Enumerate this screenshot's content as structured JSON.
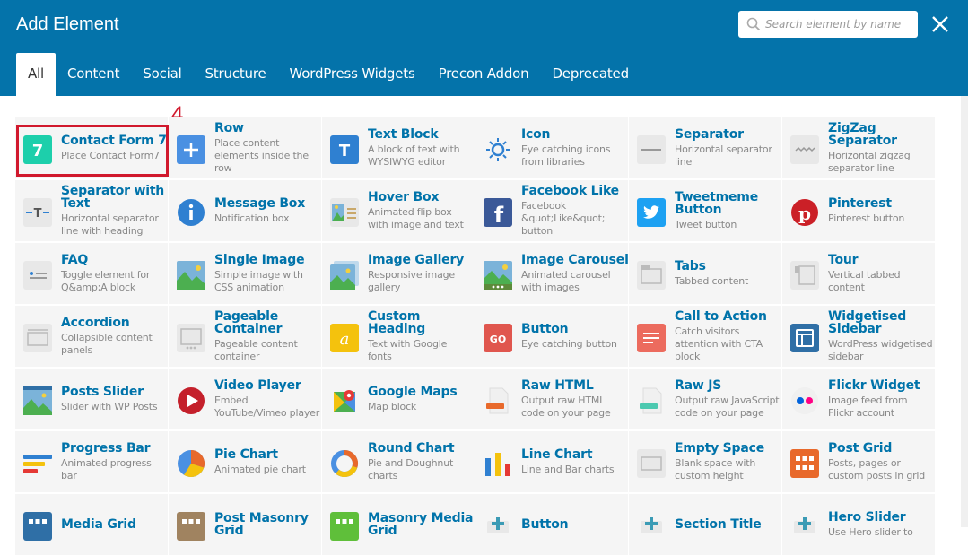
{
  "header": {
    "title": "Add Element",
    "search_placeholder": "Search element by name",
    "bg_color": "#0473aa"
  },
  "tabs": [
    {
      "label": "All",
      "active": true
    },
    {
      "label": "Content"
    },
    {
      "label": "Social"
    },
    {
      "label": "Structure"
    },
    {
      "label": "WordPress Widgets"
    },
    {
      "label": "Precon Addon"
    },
    {
      "label": "Deprecated"
    }
  ],
  "annotation": "4",
  "elements": [
    [
      {
        "name": "Contact Form 7",
        "desc": "Place Contact Form7",
        "icon": "contact-form-7-icon"
      },
      {
        "name": "Row",
        "desc": "Place content elements inside the row",
        "icon": "plus-icon"
      },
      {
        "name": "Text Block",
        "desc": "A block of text with WYSIWYG editor",
        "icon": "text-block-icon"
      },
      {
        "name": "Icon",
        "desc": "Eye catching icons from libraries",
        "icon": "sun-icon"
      },
      {
        "name": "Separator",
        "desc": "Horizontal separator line",
        "icon": "separator-icon"
      },
      {
        "name": "ZigZag Separator",
        "desc": "Horizontal zigzag separator line",
        "icon": "zigzag-icon"
      }
    ],
    [
      {
        "name": "Separator with Text",
        "desc": "Horizontal separator line with heading",
        "icon": "separator-text-icon"
      },
      {
        "name": "Message Box",
        "desc": "Notification box",
        "icon": "info-icon"
      },
      {
        "name": "Hover Box",
        "desc": "Animated flip box with image and text",
        "icon": "hover-box-icon"
      },
      {
        "name": "Facebook Like",
        "desc": "Facebook &quot;Like&quot; button",
        "icon": "facebook-icon"
      },
      {
        "name": "Tweetmeme Button",
        "desc": "Tweet button",
        "icon": "twitter-icon"
      },
      {
        "name": "Pinterest",
        "desc": "Pinterest button",
        "icon": "pinterest-icon"
      }
    ],
    [
      {
        "name": "FAQ",
        "desc": "Toggle element for Q&amp;A block",
        "icon": "faq-icon"
      },
      {
        "name": "Single Image",
        "desc": "Simple image with CSS animation",
        "icon": "image-icon"
      },
      {
        "name": "Image Gallery",
        "desc": "Responsive image gallery",
        "icon": "gallery-icon"
      },
      {
        "name": "Image Carousel",
        "desc": "Animated carousel with images",
        "icon": "carousel-icon"
      },
      {
        "name": "Tabs",
        "desc": "Tabbed content",
        "icon": "tabs-icon"
      },
      {
        "name": "Tour",
        "desc": "Vertical tabbed content",
        "icon": "tour-icon"
      }
    ],
    [
      {
        "name": "Accordion",
        "desc": "Collapsible content panels",
        "icon": "accordion-icon"
      },
      {
        "name": "Pageable Container",
        "desc": "Pageable content container",
        "icon": "pageable-icon"
      },
      {
        "name": "Custom Heading",
        "desc": "Text with Google fonts",
        "icon": "custom-heading-icon"
      },
      {
        "name": "Button",
        "desc": "Eye catching button",
        "icon": "go-button-icon"
      },
      {
        "name": "Call to Action",
        "desc": "Catch visitors attention with CTA block",
        "icon": "cta-icon"
      },
      {
        "name": "Widgetised Sidebar",
        "desc": "WordPress widgetised sidebar",
        "icon": "sidebar-icon"
      }
    ],
    [
      {
        "name": "Posts Slider",
        "desc": "Slider with WP Posts",
        "icon": "posts-slider-icon"
      },
      {
        "name": "Video Player",
        "desc": "Embed YouTube/Vimeo player",
        "icon": "play-icon"
      },
      {
        "name": "Google Maps",
        "desc": "Map block",
        "icon": "map-icon"
      },
      {
        "name": "Raw HTML",
        "desc": "Output raw HTML code on your page",
        "icon": "raw-html-icon"
      },
      {
        "name": "Raw JS",
        "desc": "Output raw JavaScript code on your page",
        "icon": "raw-js-icon"
      },
      {
        "name": "Flickr Widget",
        "desc": "Image feed from Flickr account",
        "icon": "flickr-icon"
      }
    ],
    [
      {
        "name": "Progress Bar",
        "desc": "Animated progress bar",
        "icon": "progress-bar-icon"
      },
      {
        "name": "Pie Chart",
        "desc": "Animated pie chart",
        "icon": "pie-chart-icon"
      },
      {
        "name": "Round Chart",
        "desc": "Pie and Doughnut charts",
        "icon": "round-chart-icon"
      },
      {
        "name": "Line Chart",
        "desc": "Line and Bar charts",
        "icon": "line-chart-icon"
      },
      {
        "name": "Empty Space",
        "desc": "Blank space with custom height",
        "icon": "empty-space-icon"
      },
      {
        "name": "Post Grid",
        "desc": "Posts, pages or custom posts in grid",
        "icon": "post-grid-icon"
      }
    ],
    [
      {
        "name": "Media Grid",
        "desc": "",
        "icon": "media-grid-icon"
      },
      {
        "name": "Post Masonry Grid",
        "desc": "",
        "icon": "masonry-grid-icon"
      },
      {
        "name": "Masonry Media Grid",
        "desc": "",
        "icon": "masonry-media-icon"
      },
      {
        "name": "Button",
        "desc": "",
        "icon": "button-plus-icon"
      },
      {
        "name": "Section Title",
        "desc": "",
        "icon": "section-title-icon"
      },
      {
        "name": "Hero Slider",
        "desc": "Use Hero slider to",
        "icon": "hero-slider-icon"
      }
    ]
  ]
}
